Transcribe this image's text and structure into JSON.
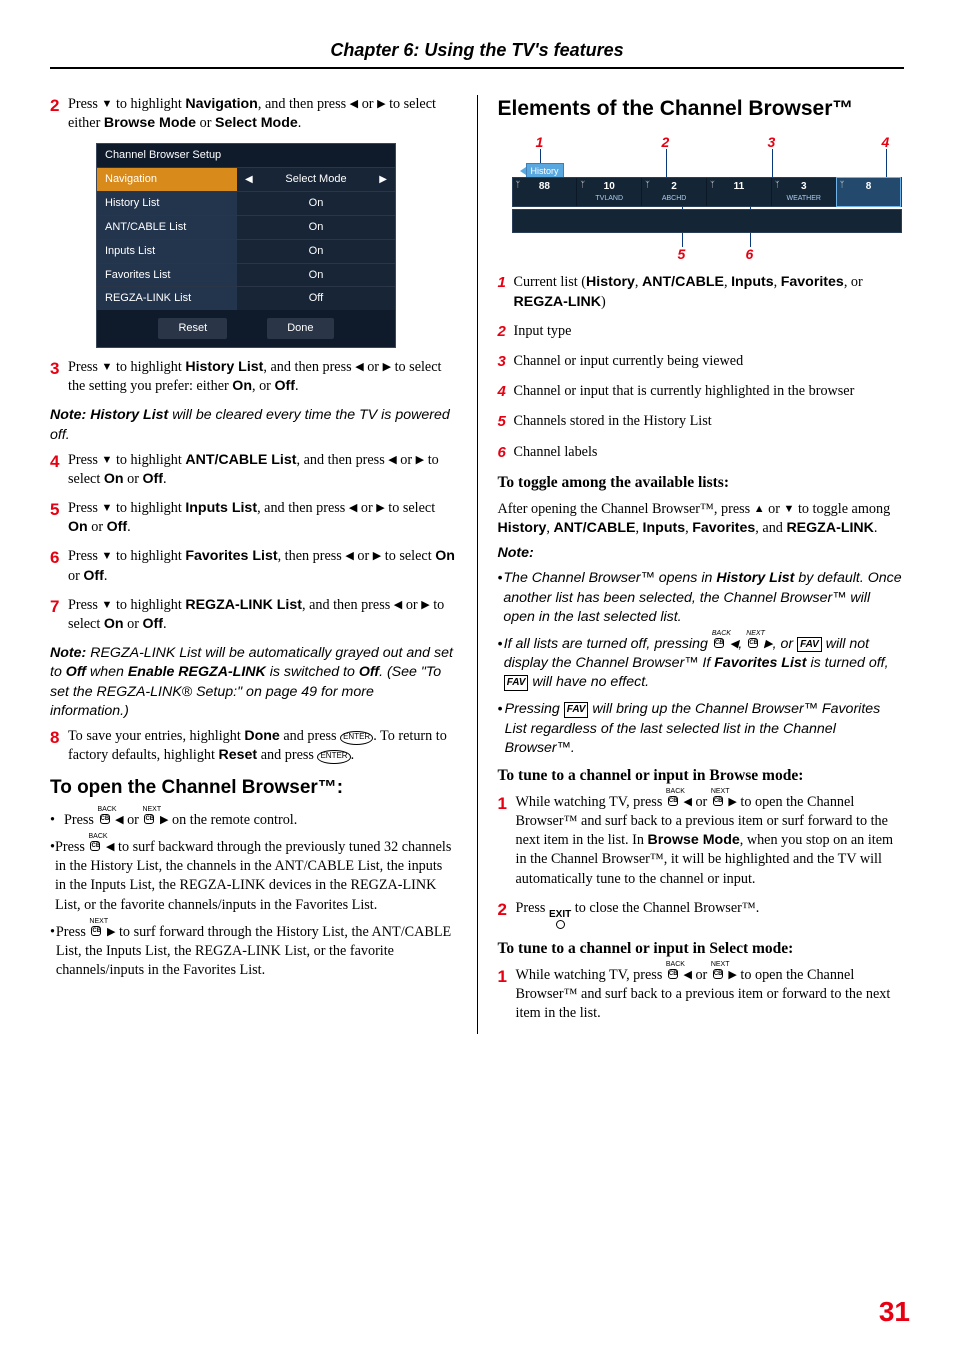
{
  "chapterHeader": "Chapter 6: Using the TV's features",
  "pageNumber": "31",
  "left": {
    "step2_pre": "Press ",
    "step2_mid1": " to highlight ",
    "step2_nav": "Navigation",
    "step2_mid2": ", and then press ",
    "step2_mid3": " or ",
    "step2_mid4": " to select either ",
    "step2_browse": "Browse Mode",
    "step2_or": " or ",
    "step2_select": "Select Mode",
    "step2_end": ".",
    "panel": {
      "title": "Channel Browser Setup",
      "rows": [
        {
          "label": "Navigation",
          "value": "Select Mode",
          "selected": true
        },
        {
          "label": "History List",
          "value": "On"
        },
        {
          "label": "ANT/CABLE List",
          "value": "On"
        },
        {
          "label": "Inputs List",
          "value": "On"
        },
        {
          "label": "Favorites List",
          "value": "On"
        },
        {
          "label": "REGZA-LINK List",
          "value": "Off"
        }
      ],
      "reset": "Reset",
      "done": "Done"
    },
    "step3a": " Press ",
    "step3b": " to highlight ",
    "step3_hist": "History List",
    "step3c": ", and then press ",
    "step3d": " or ",
    "step3e": " to select the setting you prefer: either ",
    "step3_on": "On",
    "step3f": ", or ",
    "step3_off": "Off",
    "step3g": ".",
    "note1a": "Note: ",
    "note1b": "History List",
    "note1c": " will be cleared every time the TV is powered off.",
    "step4a": "Press ",
    "step4b": " to highlight ",
    "step4_ant": "ANT/CABLE List",
    "step4c": ", and then press ",
    "step4d": " or ",
    "step4e": " to select ",
    "step4_on": "On",
    "step4f": " or ",
    "step4_off": "Off",
    "step4g": ".",
    "step5a": "Press ",
    "step5b": " to highlight ",
    "step5_inp": "Inputs List",
    "step5c": ", and then press ",
    "step5d": " or ",
    "step5e": " to select ",
    "step5_on": "On",
    "step5f": " or ",
    "step5_off": "Off",
    "step5g": ".",
    "step6a": "Press ",
    "step6b": " to highlight ",
    "step6_fav": "Favorites List",
    "step6c": ", then press ",
    "step6d": " or ",
    "step6e": " to select ",
    "step6_on": "On",
    "step6f": " or ",
    "step6_off": "Off",
    "step6g": ".",
    "step7a": "Press ",
    "step7b": " to highlight ",
    "step7_reg": "REGZA-LINK List",
    "step7c": ", and then press ",
    "step7d": " or ",
    "step7e": " to select ",
    "step7_on": "On",
    "step7f": " or ",
    "step7_off": "Off",
    "step7g": ".",
    "note2a": "Note: ",
    "note2b": "REGZA-LINK List will be automatically grayed out and set to ",
    "note2_off": "Off",
    "note2c": " when ",
    "note2_enable": "Enable REGZA-LINK",
    "note2d": " is switched to ",
    "note2_off2": "Off",
    "note2e": ". (See \"To set the REGZA-LINK® Setup:\" on page 49 for more information.)",
    "step8a": "To save your entries, highlight ",
    "step8_done": "Done",
    "step8b": " and press ",
    "step8c": ". To return to factory defaults, highlight ",
    "step8_reset": "Reset",
    "step8d": " and press ",
    "step8e": ".",
    "openH2": "To open the Channel Browser™:",
    "b1a": "Press ",
    "b1b": " or ",
    "b1c": " on the remote control.",
    "b2a": "Press ",
    "b2b": " to surf backward through the previously tuned 32 channels in the History List, the channels in the ANT/CABLE List, the inputs in the Inputs List, the REGZA-LINK devices in the REGZA-LINK List, or the favorite channels/inputs in the Favorites List.",
    "b3a": "Press ",
    "b3b": " to surf forward through the History List, the ANT/CABLE List, the Inputs List, the REGZA-LINK List, or the favorite channels/inputs in the Favorites List."
  },
  "right": {
    "h1": "Elements of the Channel Browser™",
    "diagram": {
      "labels": [
        "1",
        "2",
        "3",
        "4",
        "5",
        "6"
      ],
      "historyTag": "History",
      "strip": [
        {
          "num": "88",
          "sub": ""
        },
        {
          "num": "10",
          "sub": "TVLAND"
        },
        {
          "num": "2",
          "sub": "ABCHD"
        },
        {
          "num": "11",
          "sub": ""
        },
        {
          "num": "3",
          "sub": "WEATHER"
        },
        {
          "num": "8",
          "sub": ""
        }
      ]
    },
    "items": [
      {
        "n": "1",
        "t1": "Current list (",
        "b": "History",
        "t2": ", ",
        "b2": "ANT/CABLE",
        "t3": ", ",
        "b3": "Inputs",
        "t4": ", ",
        "b4": "Favorites",
        "t5": ", or ",
        "b5": "REGZA-LINK",
        "t6": ")"
      },
      {
        "n": "2",
        "plain": "Input type"
      },
      {
        "n": "3",
        "plain": "Channel or input currently being viewed"
      },
      {
        "n": "4",
        "plain": "Channel or input that is currently highlighted in the browser"
      },
      {
        "n": "5",
        "plain": "Channels stored in the History List"
      },
      {
        "n": "6",
        "plain": "Channel labels"
      }
    ],
    "toggleH": "To toggle among the available lists:",
    "togA": "After opening the Channel Browser™, press ",
    "togB": " or ",
    "togC": " to toggle among ",
    "togHist": "History",
    "togD": ", ",
    "togAnt": "ANT/CABLE",
    "togE": ", ",
    "togInp": "Inputs",
    "togF": ", ",
    "togFav": "Favorites",
    "togG": ", and ",
    "togReg": "REGZA-LINK",
    "togH": ".",
    "noteHeader": "Note:",
    "nbul1a": "The Channel Browser™ opens in ",
    "nbul1b": "History List",
    "nbul1c": " by default. Once another list has been selected, the Channel Browser™ will open in the last selected list.",
    "nbul2a": "If all lists are turned off, pressing ",
    "nbul2b": ", ",
    "nbul2c": ", or ",
    "nbul2d": " will not display the Channel Browser™ If ",
    "nbul2_fav": "Favorites List",
    "nbul2e": " is turned off, ",
    "nbul2f": " will have no effect.",
    "nbul3a": "Pressing ",
    "nbul3b": " will bring up the Channel Browser™ Favorites List regardless of the last selected list in the Channel Browser™.",
    "tuneBrowseH": "To tune to a channel or input in Browse mode:",
    "tb1a": "While watching TV, press ",
    "tb1b": " or ",
    "tb1c": " to open the Channel Browser™ and surf back to a previous item or surf forward to the next item in the list. In ",
    "tb1_browse": "Browse Mode",
    "tb1d": ", when you stop on an item in the Channel Browser™, it will be highlighted and the TV will automatically tune to the channel or input.",
    "tb2a": "Press ",
    "tb2b": " to close the Channel Browser™.",
    "tuneSelectH": "To tune to a channel or input in Select mode:",
    "ts1a": "While watching TV, press ",
    "ts1b": " or ",
    "ts1c": " to open the Channel Browser™ and surf back to a previous item or forward to the next item in the list."
  },
  "glyphs": {
    "back": "BACK",
    "next": "NEXT",
    "cb": "CB",
    "fav": "FAV",
    "enter": "ENTER",
    "exit": "EXIT"
  }
}
